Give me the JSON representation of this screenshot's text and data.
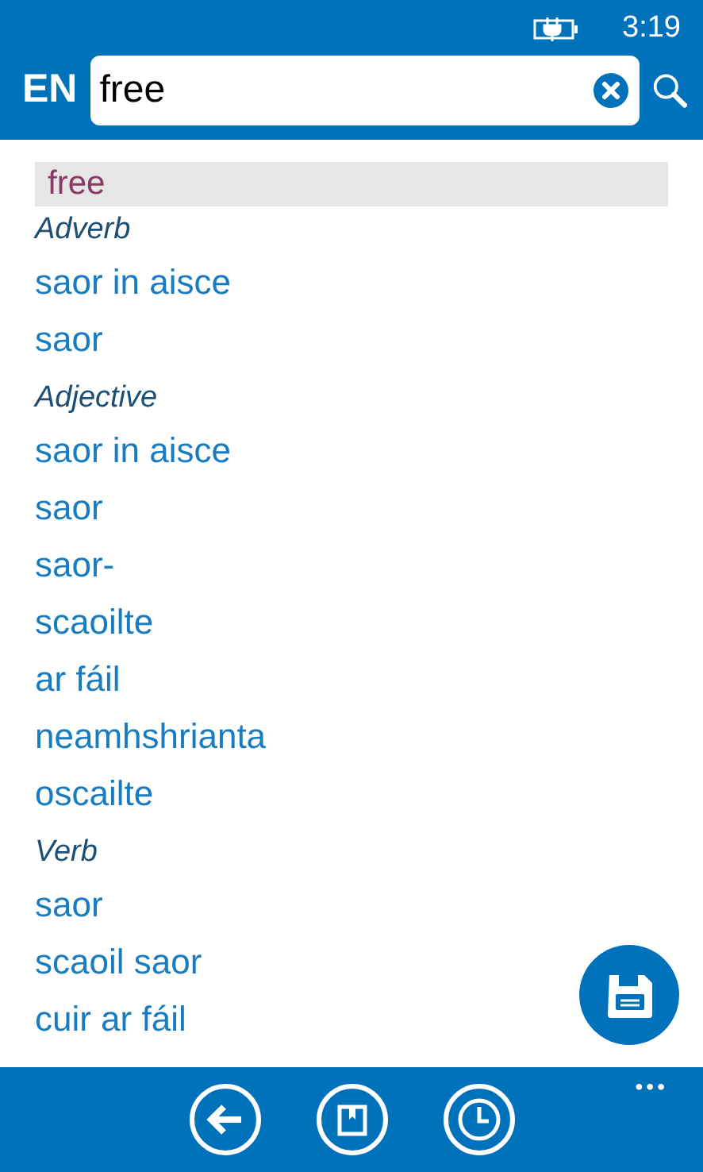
{
  "status_bar": {
    "time": "3:19"
  },
  "search": {
    "language": "EN",
    "value": "free"
  },
  "headword": "free",
  "sections": [
    {
      "pos": "Adverb",
      "translations": [
        "saor in aisce",
        "saor"
      ]
    },
    {
      "pos": "Adjective",
      "translations": [
        "saor in aisce",
        "saor",
        "saor-",
        "scaoilte",
        "ar fáil",
        "neamhshrianta",
        "oscailte"
      ]
    },
    {
      "pos": "Verb",
      "translations": [
        "saor",
        "scaoil saor",
        "cuir ar fáil"
      ]
    }
  ],
  "app_bar": {
    "more": "•••"
  }
}
